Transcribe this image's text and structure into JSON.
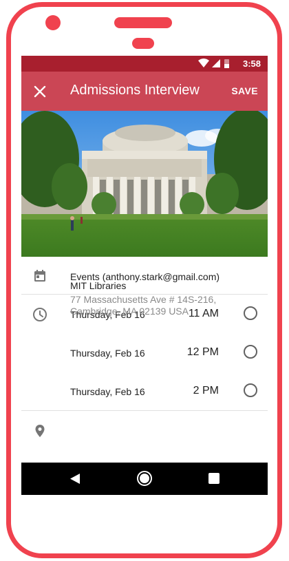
{
  "status_bar": {
    "time": "3:58",
    "icons": [
      "wifi-icon",
      "cellular-signal-icon",
      "battery-icon"
    ]
  },
  "app_bar": {
    "close_icon": "close-icon",
    "title": "Admissions Interview",
    "save_label": "SAVE"
  },
  "hero_image": {
    "description_icon": "building-photo"
  },
  "calendar": {
    "icon": "calendar-icon",
    "account": "Events (anthony.stark@gmail.com)"
  },
  "time_slots": {
    "icon": "clock-icon",
    "options": [
      {
        "date": "Thursday, Feb 16",
        "time": "11 AM",
        "selected": false
      },
      {
        "date": "Thursday, Feb 16",
        "time": "12 PM",
        "selected": false
      },
      {
        "date": "Thursday, Feb 16",
        "time": "2 PM",
        "selected": false
      }
    ]
  },
  "location": {
    "icon": "location-pin-icon",
    "name": "MIT Libraries",
    "address": "77 Massachusetts Ave # 14S-216, Cambridge, MA 02139 USA"
  },
  "nav_bar": {
    "icons": [
      "back-icon",
      "home-icon",
      "recents-icon"
    ]
  },
  "colors": {
    "status_bar": "#a81f2e",
    "app_bar": "#cb4655",
    "phone_frame": "#f0424e"
  }
}
